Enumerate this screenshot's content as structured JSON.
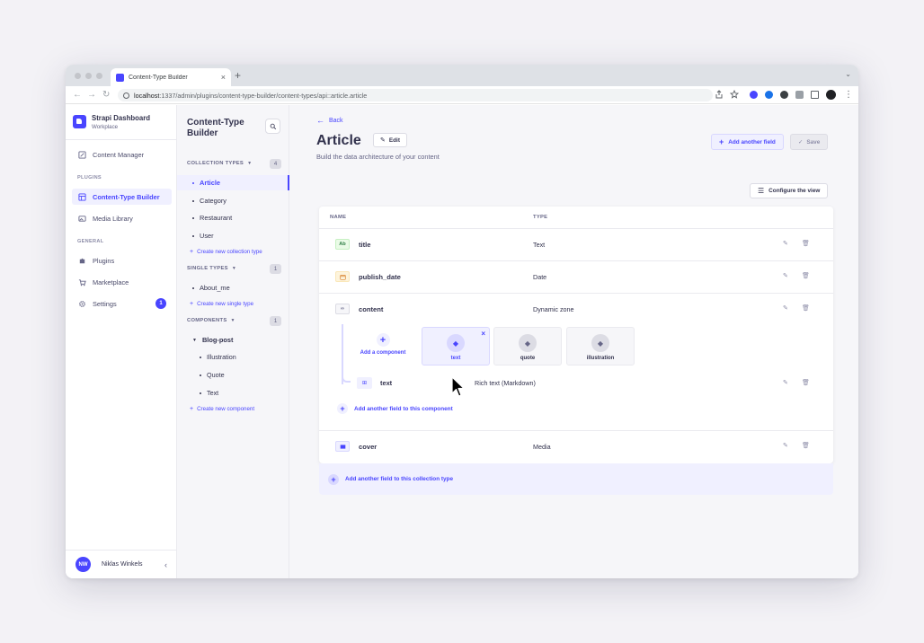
{
  "browser": {
    "tab_title": "Content-Type Builder",
    "url_host": "localhost",
    "url_path": ":1337/admin/plugins/content-type-builder/content-types/api::article.article"
  },
  "brand": {
    "name": "Strapi Dashboard",
    "workspace": "Workplace"
  },
  "mainnav": {
    "content_manager": "Content Manager",
    "plugins_section": "PLUGINS",
    "ctb": "Content-Type Builder",
    "media_library": "Media Library",
    "general_section": "GENERAL",
    "plugins": "Plugins",
    "marketplace": "Marketplace",
    "settings": "Settings",
    "settings_badge": "1"
  },
  "user": {
    "initials": "NW",
    "name": "Niklas Winkels"
  },
  "subnav": {
    "title": "Content-Type Builder",
    "collection_section": "COLLECTION TYPES",
    "collection_count": "4",
    "collection_items": [
      "Article",
      "Category",
      "Restaurant",
      "User"
    ],
    "create_collection": "Create new collection type",
    "single_section": "SINGLE TYPES",
    "single_count": "1",
    "single_items": [
      "About_me"
    ],
    "create_single": "Create new single type",
    "components_section": "COMPONENTS",
    "components_count": "1",
    "component_group": "Blog-post",
    "component_items": [
      "Illustration",
      "Quote",
      "Text"
    ],
    "create_component": "Create new component"
  },
  "main": {
    "back": "Back",
    "title": "Article",
    "edit": "Edit",
    "subtitle": "Build the data architecture of your content",
    "add_field": "Add another field",
    "save": "Save",
    "configure": "Configure the view",
    "col_name": "NAME",
    "col_type": "TYPE",
    "fields": [
      {
        "icon": "Ab",
        "name": "title",
        "type": "Text"
      },
      {
        "icon": "date-icon",
        "name": "publish_date",
        "type": "Date"
      },
      {
        "icon": "dynamic-zone-icon",
        "name": "content",
        "type": "Dynamic zone"
      },
      {
        "icon": "media-icon",
        "name": "cover",
        "type": "Media"
      }
    ],
    "add_component": "Add a component",
    "components": [
      "text",
      "quote",
      "illustration"
    ],
    "subfield": {
      "name": "text",
      "type": "Rich text (Markdown)"
    },
    "add_sub_field": "Add another field to this component",
    "add_collection_field": "Add another field to this collection type"
  },
  "help": "?",
  "colors": {
    "primary": "#4945ff",
    "primary_light": "#f0f0ff"
  }
}
